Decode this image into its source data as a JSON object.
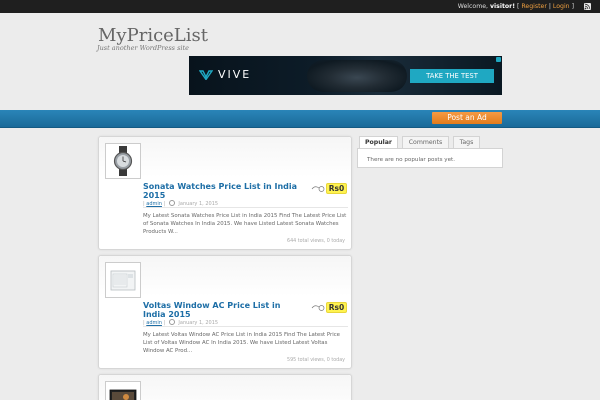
{
  "topbar": {
    "welcome_prefix": "Welcome,",
    "username": "visitor!",
    "bracket_open": "[",
    "register": "Register",
    "separator": "|",
    "login": "Login",
    "bracket_close": "]",
    "rss_icon": "rss-icon"
  },
  "header": {
    "site_title": "MyPriceList",
    "tagline": "Just another WordPress site"
  },
  "ad": {
    "brand": "VIVE",
    "cta": "TAKE THE TEST",
    "accent_color": "#1fa8c2"
  },
  "nav": {
    "post_ad_label": "Post an Ad",
    "bar_color": "#1f78ab",
    "button_color": "#ef8a2c"
  },
  "posts": [
    {
      "title": "Sonata Watches Price List in India 2015",
      "price": "Rs0",
      "author": "admin",
      "date": "January 1, 2015",
      "excerpt": "My Latest Sonata Watches Price List in India 2015 Find The Latest Price List of Sonata Watches In India 2015. We have Listed Latest Sonata Watches Products W...",
      "views": "644 total views, 0 today",
      "thumb_icon": "watch-thumbnail"
    },
    {
      "title": "Voltas Window AC Price List in India 2015",
      "price": "Rs0",
      "author": "admin",
      "date": "January 1, 2015",
      "excerpt": "My Latest Voltas Window AC Price List in India 2015 Find The Latest Price List of Voltas Window AC In India 2015. We have Listed Latest Voltas Window AC Prod...",
      "views": "595 total views, 0 today",
      "thumb_icon": "air-conditioner-thumbnail"
    }
  ],
  "sidebar": {
    "tabs": [
      "Popular",
      "Comments",
      "Tags"
    ],
    "active_tab": "Popular",
    "empty_message": "There are no popular posts yet."
  }
}
